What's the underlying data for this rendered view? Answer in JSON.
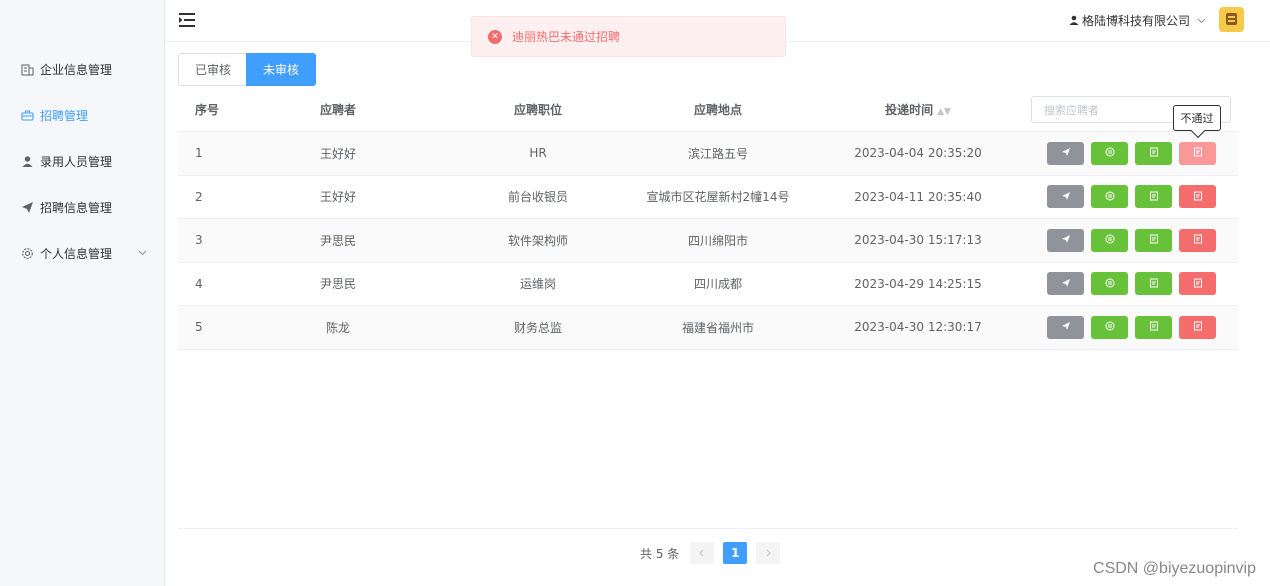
{
  "sidebar": {
    "items": [
      {
        "label": "企业信息管理",
        "icon": "building-icon"
      },
      {
        "label": "招聘管理",
        "icon": "briefcase-icon",
        "active": true
      },
      {
        "label": "录用人员管理",
        "icon": "user-icon"
      },
      {
        "label": "招聘信息管理",
        "icon": "send-icon"
      },
      {
        "label": "个人信息管理",
        "icon": "gear-icon"
      }
    ]
  },
  "header": {
    "company": "格陆博科技有限公司"
  },
  "toast": {
    "message": "迪丽热巴未通过招聘",
    "type": "error"
  },
  "tabs": {
    "reviewed": "已审核",
    "unreviewed": "未审核",
    "active": "未审核"
  },
  "search": {
    "placeholder": "搜索应聘者"
  },
  "table": {
    "columns": [
      "序号",
      "应聘者",
      "应聘职位",
      "应聘地点",
      "投递时间"
    ],
    "rows": [
      {
        "index": "1",
        "applicant": "王好好",
        "position": "HR",
        "location": "滨江路五号",
        "time": "2023-04-04 20:35:20"
      },
      {
        "index": "2",
        "applicant": "王好好",
        "position": "前台收银员",
        "location": "宣城市区花屋新村2幢14号",
        "time": "2023-04-11 20:35:40"
      },
      {
        "index": "3",
        "applicant": "尹思民",
        "position": "软件架构师",
        "location": "四川绵阳市",
        "time": "2023-04-30 15:17:13"
      },
      {
        "index": "4",
        "applicant": "尹思民",
        "position": "运维岗",
        "location": "四川成都",
        "time": "2023-04-29 14:25:15"
      },
      {
        "index": "5",
        "applicant": "陈龙",
        "position": "财务总监",
        "location": "福建省福州市",
        "time": "2023-04-30 12:30:17"
      }
    ]
  },
  "tooltip": {
    "text": "不通过"
  },
  "pagination": {
    "total": "共 5 条",
    "current": "1"
  },
  "watermark": "CSDN @biyezuopinvip",
  "colors": {
    "primary": "#409eff",
    "success": "#67c23a",
    "danger": "#f56c6c",
    "info": "#909399"
  }
}
